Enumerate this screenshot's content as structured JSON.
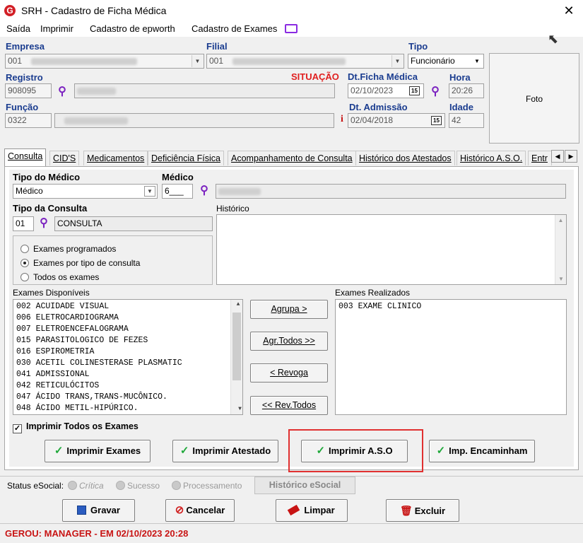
{
  "window": {
    "title": "SRH - Cadastro de Ficha Médica",
    "app_icon": "G"
  },
  "menu": {
    "items": [
      "Saída",
      "Imprimir",
      "Cadastro de epworth",
      "Cadastro de Exames"
    ]
  },
  "header": {
    "empresa_label": "Empresa",
    "empresa_code": "001",
    "filial_label": "Filial",
    "filial_code": "001",
    "tipo_label": "Tipo",
    "tipo_value": "Funcionário",
    "foto_label": "Foto",
    "registro_label": "Registro",
    "registro_value": "908095",
    "situacao_label": "SITUAÇÃO",
    "dt_ficha_label": "Dt.Ficha Médica",
    "dt_ficha_value": "02/10/2023",
    "hora_label": "Hora",
    "hora_value": "20:26",
    "funcao_label": "Função",
    "funcao_value": "0322",
    "info_icon": "i",
    "dt_admissao_label": "Dt. Admissão",
    "dt_admissao_value": "02/04/2018",
    "idade_label": "Idade",
    "idade_value": "42",
    "calendar_glyph": "15"
  },
  "tabs": [
    "Consulta",
    "CID'S",
    "Medicamentos",
    "Deficiência Física",
    "Acompanhamento de Consulta",
    "Histórico dos Atestados",
    "Histórico A.S.O.",
    "Entr"
  ],
  "consulta": {
    "tipo_medico_label": "Tipo do Médico",
    "tipo_medico_value": "Médico",
    "medico_label": "Médico",
    "medico_value": "6___",
    "tipo_consulta_label": "Tipo da Consulta",
    "tipo_consulta_code": "01",
    "tipo_consulta_value": "CONSULTA",
    "historico_label": "Histórico",
    "radio_options": [
      "Exames programados",
      "Exames por tipo de consulta",
      "Todos os exames"
    ],
    "radio_selected": 1,
    "disponiveis_label": "Exames Disponíveis",
    "disponiveis": [
      "002 ACUIDADE VISUAL",
      "006 ELETROCARDIOGRAMA",
      "007 ELETROENCEFALOGRAMA",
      "015 PARASITOLOGICO DE FEZES",
      "016 ESPIROMETRIA",
      "030 ACETIL COLINESTERASE PLASMATIC",
      "041 ADMISSIONAL",
      "042 RETICULÓCITOS",
      "047 ÁCIDO TRANS,TRANS-MUCÔNICO.",
      "048 ÁCIDO METIL-HIPÚRICO."
    ],
    "realizados_label": "Exames Realizados",
    "realizados": [
      "003 EXAME CLINICO"
    ],
    "btn_agrupa": "Agrupa >",
    "btn_agr_todos": "Agr.Todos >>",
    "btn_revoga": "< Revoga",
    "btn_rev_todos": "<< Rev.Todos",
    "imprimir_todos_label": "Imprimir Todos os Exames",
    "btn_imprimir_exames": "Imprimir Exames",
    "btn_imprimir_atestado": "Imprimir Atestado",
    "btn_imprimir_aso": "Imprimir A.S.O",
    "btn_imp_encaminham": "Imp. Encaminham"
  },
  "status_esocial": {
    "label": "Status eSocial:",
    "options": [
      "Crítica",
      "Sucesso",
      "Processamento"
    ],
    "historico_btn": "Histórico eSocial"
  },
  "actions": {
    "gravar": "Gravar",
    "cancelar": "Cancelar",
    "limpar": "Limpar",
    "excluir": "Excluir"
  },
  "footer": {
    "status": "GEROU: MANAGER - EM 02/10/2023 20:28"
  },
  "colors": {
    "label_blue": "#1a3c8f",
    "situacao_red": "#e02020",
    "footer_red": "#c81414",
    "highlight": "#e03030"
  }
}
